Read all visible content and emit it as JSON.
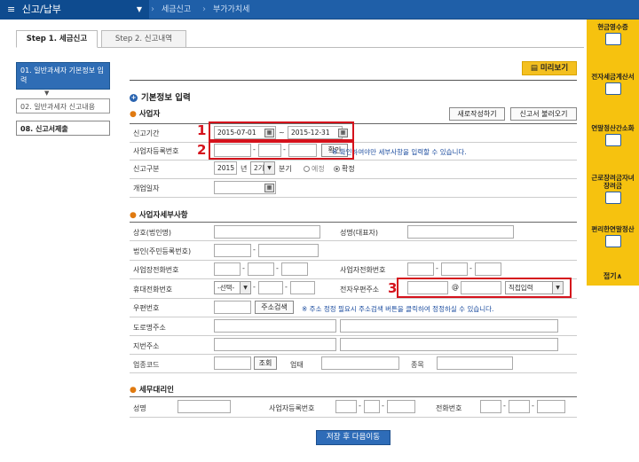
{
  "topbar": {
    "menu": "신고/납부",
    "menu_icon": "hamburger-icon",
    "crumb1": "세금신고",
    "crumb2": "부가가치세"
  },
  "tabs": [
    {
      "label": "Step 1. 세금신고"
    },
    {
      "label": "Step 2. 신고내역"
    }
  ],
  "sidebar": {
    "items": [
      {
        "label": "01. 일반과세자 기본정보 입력"
      },
      {
        "label": "02. 일반과세자 신고내용"
      },
      {
        "label": "08. 신고서제출"
      }
    ]
  },
  "rightbar": {
    "items": [
      {
        "label": "현금영수증",
        "icon": "receipt-icon"
      },
      {
        "label": "전자세금계산서",
        "icon": "invoice-icon"
      },
      {
        "label": "연말정산간소화",
        "icon": "calculator-icon"
      },
      {
        "label": "근로장려금자녀장려금",
        "icon": "heart-icon"
      },
      {
        "label": "편리한연말정산",
        "icon": "wallet-icon"
      }
    ],
    "collapse": "접기∧"
  },
  "preview_button": "미리보기",
  "section_title": "기본정보 입력",
  "business": {
    "heading": "사업자",
    "new_button": "새로작성하기",
    "load_button": "신고서 불러오기",
    "period_label": "신고기간",
    "period_from": "2015-07-01",
    "period_to": "2015-12-31",
    "period_sep": "~",
    "reg_label": "사업자등록번호",
    "confirm_button": "확인",
    "reg_note": "※ 확인하여야만 세부사항을 입력할 수 있습니다.",
    "type_label": "신고구분",
    "year": "2015",
    "year_unit": "년",
    "term": "2기",
    "term_unit": "분기",
    "radio_pre": "예정",
    "radio_final": "확정",
    "open_label": "개업일자"
  },
  "details": {
    "heading": "사업자세부사항",
    "company_label": "상호(법인명)",
    "ceo_label": "성명(대표자)",
    "corp_label": "법인(주민등록번호)",
    "office_phone_label": "사업장전화번호",
    "home_phone_label": "사업자전화번호",
    "mobile_label": "휴대전화번호",
    "mobile_select": "-선택-",
    "email_label": "전자우편주소",
    "email_at": "@",
    "email_direct": "직접입력",
    "zip_label": "우편번호",
    "zip_button": "주소검색",
    "zip_note": "※ 주소 정정 필요시 주소검색 버튼을 클릭하여 정정하실 수 있습니다.",
    "road_label": "도로명주소",
    "lot_label": "지번주소",
    "industry_label": "업종코드",
    "lookup_button": "조회",
    "biz_type_label": "업태",
    "item_label": "종목"
  },
  "agent": {
    "heading": "세무대리인",
    "name_label": "성명",
    "reg_label": "사업자등록번호",
    "phone_label": "전화번호"
  },
  "annotations": {
    "n1": "1",
    "n2": "2",
    "n3": "3"
  },
  "save_button": "저장 후 다음이동",
  "colors": {
    "brand": "#1f5fa8",
    "highlight": "#d5121c",
    "accent": "#f6c20f"
  }
}
